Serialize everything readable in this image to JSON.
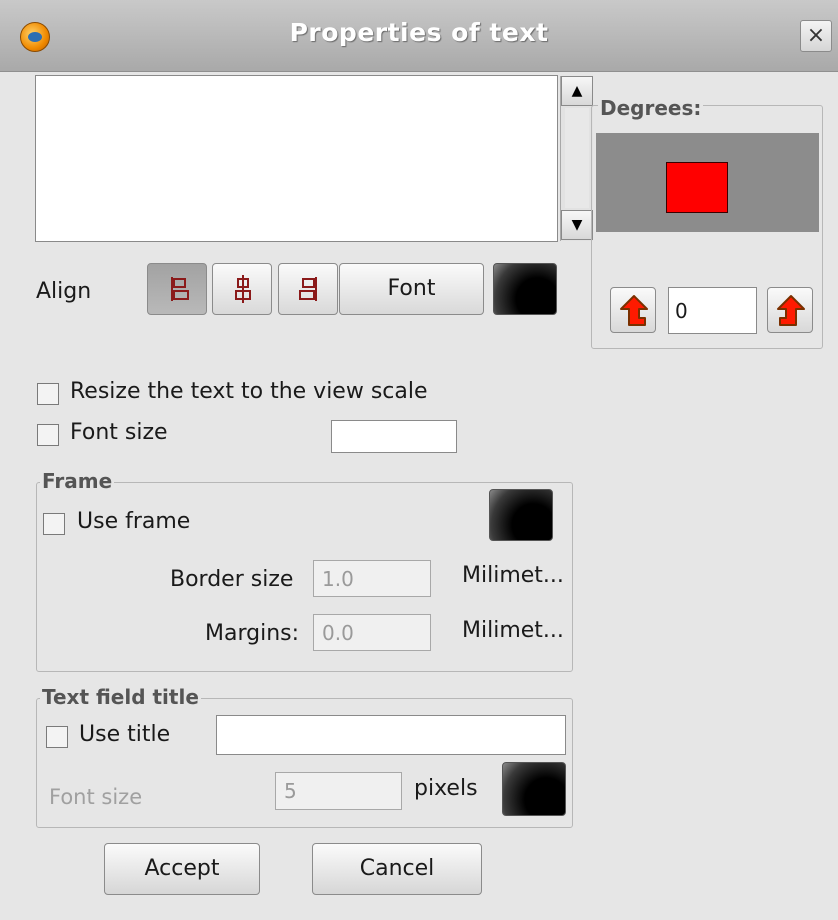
{
  "window": {
    "title": "Properties of text",
    "close_label": "×"
  },
  "text_area": {
    "value": ""
  },
  "align": {
    "label": "Align",
    "font_button_label": "Font",
    "left_icon": "align-left-icon",
    "center_icon": "align-center-icon",
    "right_icon": "align-right-icon",
    "selected": "left"
  },
  "options": {
    "resize_label": "Resize the text to the view scale",
    "resize_checked": false,
    "font_size_label": "Font size",
    "font_size_checked": false,
    "font_size_value": ""
  },
  "frame": {
    "legend": "Frame",
    "use_frame_label": "Use frame",
    "use_frame_checked": false,
    "border_size_label": "Border size",
    "border_size_value": "1.0",
    "border_unit": "Milimet...",
    "margins_label": "Margins:",
    "margins_value": "0.0",
    "margins_unit": "Milimet..."
  },
  "title_field": {
    "legend": "Text field title",
    "use_title_label": "Use title",
    "use_title_checked": false,
    "title_value": "",
    "font_size_label": "Font size",
    "font_size_value": "5",
    "pixels_label": "pixels"
  },
  "buttons": {
    "accept": "Accept",
    "cancel": "Cancel"
  },
  "degrees": {
    "legend": "Degrees:",
    "value": "0",
    "rotate_left_icon": "rotate-left-arrow-icon",
    "rotate_right_icon": "rotate-right-arrow-icon"
  },
  "colors": {
    "preview_background": "#8c8c8c",
    "preview_rect": "#ff0000",
    "swatch": "#000000",
    "arrow_fill": "#ff1a00",
    "arrow_stroke": "#7a3000"
  }
}
